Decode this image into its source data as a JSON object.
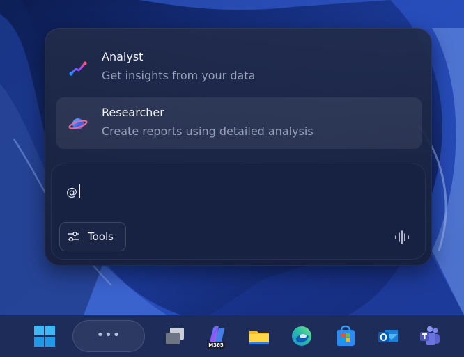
{
  "wallpaper": {
    "icon": "windows-11-bloom-wallpaper",
    "colors": [
      "#0b1a4a",
      "#2a51c6",
      "#6b8fe6"
    ]
  },
  "copilot_panel": {
    "agents": [
      {
        "title": "Analyst",
        "description": "Get insights from your data",
        "icon": "analyst-icon",
        "accent": "#e04b8f"
      },
      {
        "title": "Researcher",
        "description": "Create reports using detailed analysis",
        "icon": "researcher-icon",
        "accent": "#3d7ff0"
      }
    ],
    "prompt": {
      "value": "@"
    },
    "tools_label": "Tools",
    "tools_icon": "tools-sliders-icon",
    "voice_icon": "voice-waveform-icon"
  },
  "taskbar": {
    "pill_text": "•••",
    "m365_label": "M365",
    "icons": [
      "windows-start-icon",
      "task-view-icon",
      "microsoft-365-copilot-icon",
      "file-explorer-icon",
      "edge-icon",
      "microsoft-store-icon",
      "outlook-icon",
      "teams-icon"
    ]
  },
  "colors": {
    "panel": "#212b4a",
    "text_primary": "#f2f4fa",
    "text_secondary": "#97a0b8",
    "taskbar": "#1d2c58"
  }
}
